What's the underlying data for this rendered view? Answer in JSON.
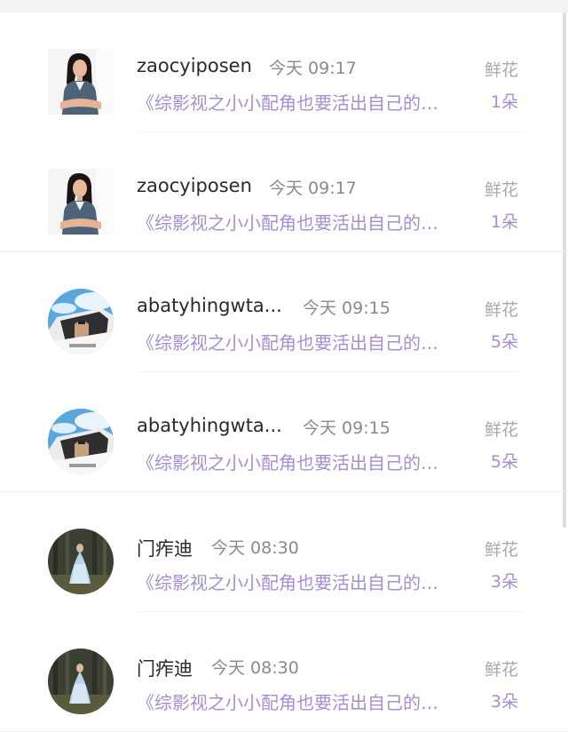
{
  "gift_items": [
    {
      "username": "zaocyiposen",
      "time": "今天 09:17",
      "gift": "鲜花",
      "title": "《综影视之小小配角也要活出自己的…",
      "count": "1朵",
      "avatar": "woman-portrait"
    },
    {
      "username": "zaocyiposen",
      "time": "今天 09:17",
      "gift": "鲜花",
      "title": "《综影视之小小配角也要活出自己的…",
      "count": "1朵",
      "avatar": "woman-portrait"
    },
    {
      "username": "abatyhingwta...",
      "time": "今天 09:15",
      "gift": "鲜花",
      "title": "《综影视之小小配角也要活出自己的…",
      "count": "5朵",
      "avatar": "car-photo"
    },
    {
      "username": "abatyhingwta...",
      "time": "今天 09:15",
      "gift": "鲜花",
      "title": "《综影视之小小配角也要活出自己的…",
      "count": "5朵",
      "avatar": "car-photo"
    },
    {
      "username": "门痄迪",
      "time": "今天 08:30",
      "gift": "鲜花",
      "title": "《综影视之小小配角也要活出自己的…",
      "count": "3朵",
      "avatar": "forest-dress-photo"
    },
    {
      "username": "门痄迪",
      "time": "今天 08:30",
      "gift": "鲜花",
      "title": "《综影视之小小配角也要活出自己的…",
      "count": "3朵",
      "avatar": "forest-dress-photo"
    }
  ],
  "colors": {
    "accent": "#a58fd2",
    "text": "#2a2a2a",
    "muted": "#8a8a8a"
  }
}
